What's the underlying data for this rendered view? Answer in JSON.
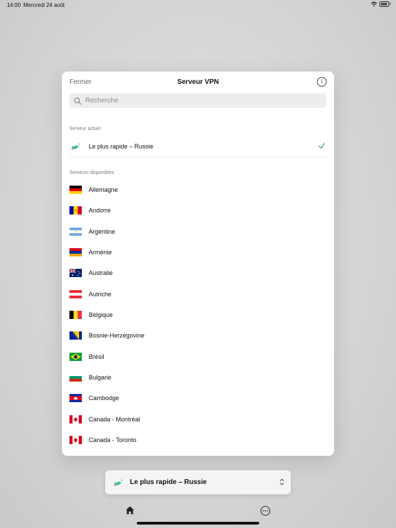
{
  "status_bar": {
    "time": "14:00",
    "date": "Mercredi 24 août"
  },
  "modal": {
    "close_label": "Fermer",
    "title": "Serveur VPN",
    "info_icon": "info-icon",
    "search_placeholder": "Recherche",
    "current_section_label": "Serveur actuel",
    "current_server": "Le plus rapide – Russie",
    "available_section_label": "Serveurs disponibles",
    "servers": [
      {
        "name": "Allemagne",
        "flag": "de"
      },
      {
        "name": "Andorre",
        "flag": "ad"
      },
      {
        "name": "Argentine",
        "flag": "ar"
      },
      {
        "name": "Arménie",
        "flag": "am"
      },
      {
        "name": "Australie",
        "flag": "au"
      },
      {
        "name": "Autriche",
        "flag": "at"
      },
      {
        "name": "Belgique",
        "flag": "be"
      },
      {
        "name": "Bosnie-Herzégovine",
        "flag": "ba"
      },
      {
        "name": "Brésil",
        "flag": "br"
      },
      {
        "name": "Bulgarie",
        "flag": "bg"
      },
      {
        "name": "Cambodge",
        "flag": "kh"
      },
      {
        "name": "Canada - Montréal",
        "flag": "ca"
      },
      {
        "name": "Canada - Toronto",
        "flag": "ca"
      }
    ]
  },
  "bottom_selector": {
    "label": "Le plus rapide – Russie"
  },
  "tab_bar": {
    "items": [
      "home-icon",
      "more-icon"
    ]
  },
  "colors": {
    "accent_check": "#2a9d8f",
    "rocket_green": "#3bbf9e"
  }
}
